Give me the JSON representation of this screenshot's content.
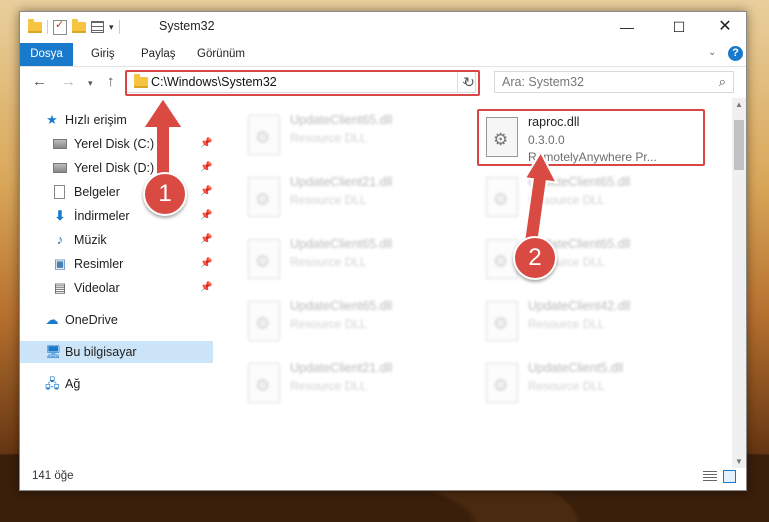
{
  "window": {
    "title": "System32"
  },
  "controls": {
    "minimize": "—",
    "maximize": "☐",
    "close": "✕"
  },
  "ribbon": {
    "tabs": [
      "Dosya",
      "Giriş",
      "Paylaş",
      "Görünüm"
    ]
  },
  "address": {
    "path": "C:\\Windows\\System32"
  },
  "search": {
    "placeholder": "Ara: System32"
  },
  "sidebar": {
    "quick_access": "Hızlı erişim",
    "items": [
      {
        "label": "Yerel Disk (C:)",
        "icon": "drive-icon",
        "pinned": true
      },
      {
        "label": "Yerel Disk (D:)",
        "icon": "drive-icon",
        "pinned": true
      },
      {
        "label": "Belgeler",
        "icon": "documents-icon",
        "pinned": true
      },
      {
        "label": "İndirmeler",
        "icon": "download-icon",
        "pinned": true
      },
      {
        "label": "Müzik",
        "icon": "music-icon",
        "pinned": true
      },
      {
        "label": "Resimler",
        "icon": "pictures-icon",
        "pinned": true
      },
      {
        "label": "Videolar",
        "icon": "videos-icon",
        "pinned": true
      }
    ],
    "onedrive": "OneDrive",
    "this_pc": "Bu bilgisayar",
    "network": "Ağ"
  },
  "files": {
    "featured": {
      "name": "raproc.dll",
      "version": "0.3.0.0",
      "company": "RemotelyAnywhere Pr..."
    },
    "background_left": [
      {
        "name": "UpdateClient65.dll",
        "type": "Resource DLL"
      },
      {
        "name": "UpdateClient21.dll",
        "type": "Resource DLL"
      },
      {
        "name": "UpdateClient65.dll",
        "type": "Resource DLL"
      },
      {
        "name": "UpdateClient65.dll",
        "type": "Resource DLL"
      },
      {
        "name": "UpdateClient21.dll",
        "type": "Resource DLL"
      }
    ],
    "background_right": [
      {
        "name": "UpdateClient65.dll",
        "type": "Resource DLL"
      },
      {
        "name": "UpdateClient65.dll",
        "type": "Resource DLL"
      },
      {
        "name": "UpdateClient42.dll",
        "type": "Resource DLL"
      },
      {
        "name": "UpdateClient5.dll",
        "type": "Resource DLL"
      }
    ]
  },
  "status": {
    "count": "141 öğe"
  },
  "callouts": {
    "one": "1",
    "two": "2"
  },
  "colors": {
    "accent": "#1979ca",
    "highlight": "#d84747"
  }
}
